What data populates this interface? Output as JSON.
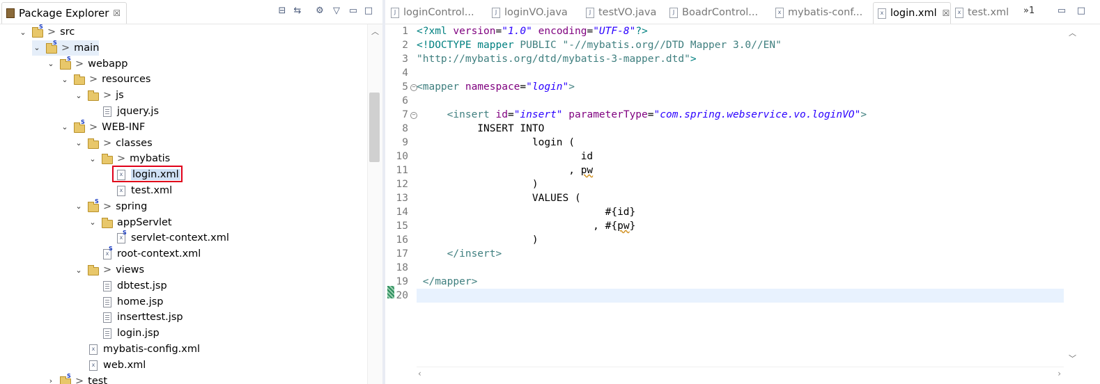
{
  "left_panel": {
    "title": "Package Explorer",
    "tree": [
      {
        "label": "src",
        "indent": 0,
        "icon": "package-folder-icon",
        "prefix": ">",
        "expanded": true
      },
      {
        "label": "main",
        "indent": 1,
        "icon": "package-folder-icon",
        "prefix": ">",
        "expanded": true,
        "highlight": true
      },
      {
        "label": "webapp",
        "indent": 2,
        "icon": "package-folder-icon",
        "prefix": ">",
        "expanded": true
      },
      {
        "label": "resources",
        "indent": 3,
        "icon": "folder-icon",
        "prefix": ">",
        "expanded": true
      },
      {
        "label": "js",
        "indent": 4,
        "icon": "folder-icon",
        "prefix": ">",
        "expanded": true
      },
      {
        "label": "jquery.js",
        "indent": 5,
        "icon": "js-file-icon",
        "prefix": "",
        "expanded": null
      },
      {
        "label": "WEB-INF",
        "indent": 3,
        "icon": "package-folder-icon",
        "prefix": ">",
        "expanded": true
      },
      {
        "label": "classes",
        "indent": 4,
        "icon": "folder-icon",
        "prefix": ">",
        "expanded": true
      },
      {
        "label": "mybatis",
        "indent": 5,
        "icon": "folder-icon",
        "prefix": ">",
        "expanded": true
      },
      {
        "label": "login.xml",
        "indent": 6,
        "icon": "xml-file-icon",
        "prefix": "",
        "expanded": null,
        "selected": true
      },
      {
        "label": "test.xml",
        "indent": 6,
        "icon": "xml-file-icon",
        "prefix": "",
        "expanded": null
      },
      {
        "label": "spring",
        "indent": 4,
        "icon": "package-folder-icon",
        "prefix": ">",
        "expanded": true
      },
      {
        "label": "appServlet",
        "indent": 5,
        "icon": "folder-icon",
        "prefix": "",
        "expanded": true
      },
      {
        "label": "servlet-context.xml",
        "indent": 6,
        "icon": "spring-xml-icon",
        "prefix": "",
        "expanded": null
      },
      {
        "label": "root-context.xml",
        "indent": 5,
        "icon": "spring-xml-icon",
        "prefix": "",
        "expanded": null
      },
      {
        "label": "views",
        "indent": 4,
        "icon": "folder-icon",
        "prefix": ">",
        "expanded": true
      },
      {
        "label": "dbtest.jsp",
        "indent": 5,
        "icon": "jsp-file-icon",
        "prefix": "",
        "expanded": null
      },
      {
        "label": "home.jsp",
        "indent": 5,
        "icon": "jsp-file-icon",
        "prefix": "",
        "expanded": null
      },
      {
        "label": "inserttest.jsp",
        "indent": 5,
        "icon": "jsp-file-icon",
        "prefix": "",
        "expanded": null
      },
      {
        "label": "login.jsp",
        "indent": 5,
        "icon": "jsp-file-icon",
        "prefix": "",
        "expanded": null
      },
      {
        "label": "mybatis-config.xml",
        "indent": 4,
        "icon": "xml-file-icon",
        "prefix": "",
        "expanded": null
      },
      {
        "label": "web.xml",
        "indent": 4,
        "icon": "xml-file-icon",
        "prefix": "",
        "expanded": null
      },
      {
        "label": "test",
        "indent": 2,
        "icon": "package-folder-icon",
        "prefix": ">",
        "expanded": false
      }
    ]
  },
  "editor": {
    "tabs": [
      {
        "label": "loginControl...",
        "icon": "java-file-icon",
        "active": false
      },
      {
        "label": "loginVO.java",
        "icon": "java-file-icon",
        "active": false
      },
      {
        "label": "testVO.java",
        "icon": "java-file-icon",
        "active": false
      },
      {
        "label": "BoadrControl...",
        "icon": "java-file-icon",
        "active": false
      },
      {
        "label": "mybatis-conf...",
        "icon": "xml-file-icon",
        "active": false
      },
      {
        "label": "login.xml",
        "icon": "xml-file-icon",
        "active": true
      },
      {
        "label": "test.xml",
        "icon": "xml-file-icon",
        "active": false
      }
    ],
    "overflow_label": "»1",
    "current_line": 20
  },
  "colors": {
    "selection_box": "#e0001a",
    "current_line_bg": "#e8f2fe",
    "xml_tag": "#3f7f7f",
    "xml_attr": "#7f007f",
    "xml_value": "#2a00ff"
  }
}
